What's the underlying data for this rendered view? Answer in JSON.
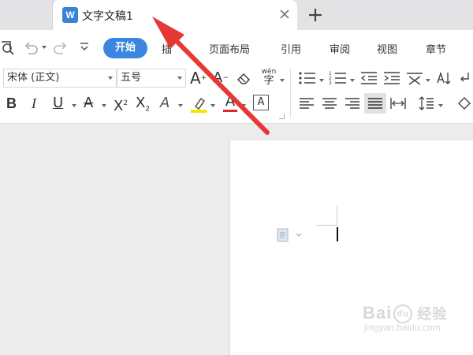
{
  "tabs": {
    "doc_icon_letter": "W",
    "active_title": "文字文稿1"
  },
  "ribbon": {
    "tabs": [
      {
        "label": "开始",
        "active": true
      },
      {
        "label": "插"
      },
      {
        "label": "页面布局"
      },
      {
        "label": "引用"
      },
      {
        "label": "审阅"
      },
      {
        "label": "视图"
      },
      {
        "label": "章节"
      }
    ],
    "font_name": "宋体 (正文)",
    "font_size": "五号",
    "icon_labels": {
      "grow_font": "A",
      "shrink_font": "A",
      "pinyin_guide": "wén",
      "pinyin_char": "字",
      "bold": "B",
      "italic": "I",
      "underline": "U",
      "strikethrough": "A",
      "superscript_base": "X",
      "superscript_mark": "2",
      "subscript_base": "X",
      "subscript_mark": "2",
      "text_effect": "A",
      "font_color": "A",
      "char_border": "A"
    }
  },
  "colors": {
    "accent": "#3b86de",
    "highlight": "#f5e300",
    "font_color_bar": "#d9282f",
    "arrow": "#e53935"
  },
  "watermark": {
    "brand": "Bai",
    "paw": "du",
    "suffix": "经验",
    "url": "jingyan.baidu.com"
  }
}
